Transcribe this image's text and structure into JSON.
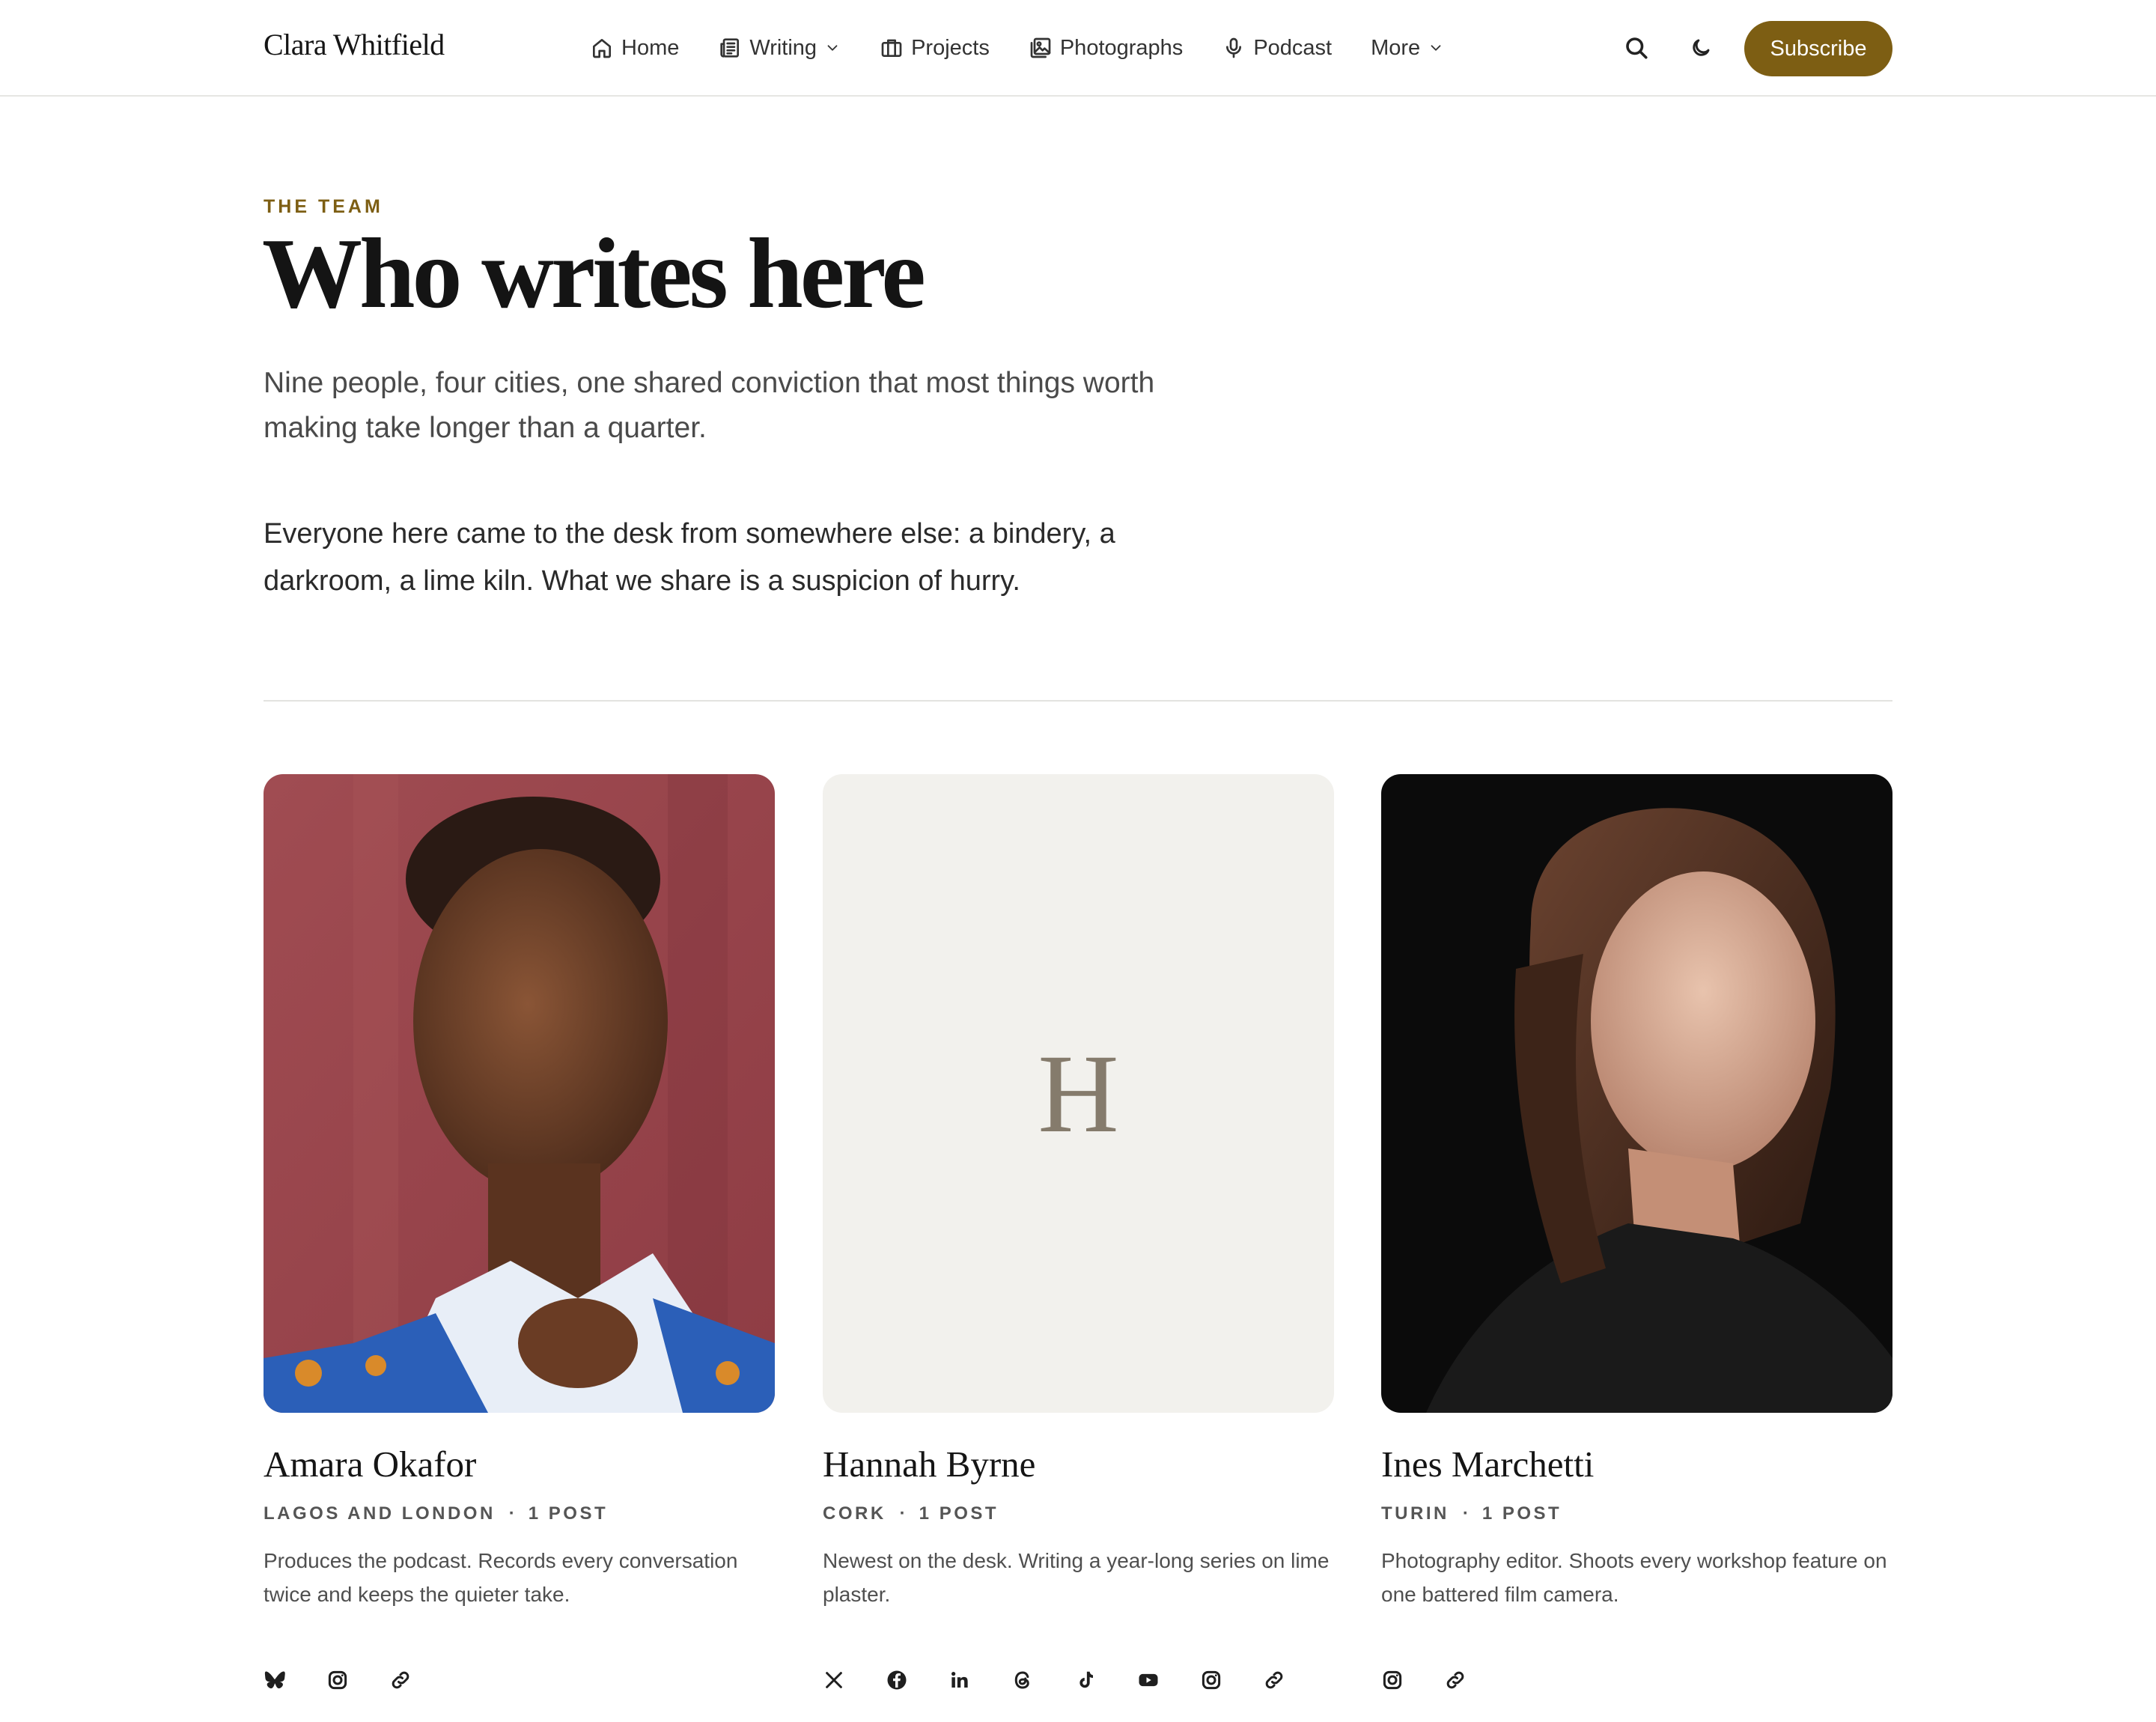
{
  "header": {
    "logo": "Clara Whitfield",
    "nav": [
      {
        "label": "Home",
        "icon": "home-icon"
      },
      {
        "label": "Writing",
        "icon": "newspaper-icon",
        "dropdown": true
      },
      {
        "label": "Projects",
        "icon": "briefcase-icon"
      },
      {
        "label": "Photographs",
        "icon": "image-icon"
      },
      {
        "label": "Podcast",
        "icon": "microphone-icon"
      },
      {
        "label": "More",
        "dropdown": true
      }
    ],
    "search_icon": "search-icon",
    "theme_icon": "moon-icon",
    "subscribe_label": "Subscribe"
  },
  "hero": {
    "eyebrow": "THE TEAM",
    "title": "Who writes here",
    "lead": "Nine people, four cities, one shared conviction that most things worth making take longer than a quarter.",
    "intro": "Everyone here came to the desk from somewhere else: a bindery, a darkroom, a lime kiln. What we share is a suspicion of hurry."
  },
  "team": [
    {
      "name": "Amara Okafor",
      "location": "LAGOS AND LONDON",
      "posts": "1 POST",
      "bio": "Produces the podcast. Records every conversation twice and keeps the quieter take.",
      "photo": "portrait-photo",
      "socials": [
        "bluesky-icon",
        "instagram-icon",
        "link-icon"
      ]
    },
    {
      "name": "Hannah Byrne",
      "location": "CORK",
      "posts": "1 POST",
      "bio": "Newest on the desk. Writing a year-long series on lime plaster.",
      "initial": "H",
      "socials": [
        "x-icon",
        "facebook-icon",
        "linkedin-icon",
        "threads-icon",
        "tiktok-icon",
        "youtube-icon",
        "instagram-icon",
        "link-icon"
      ]
    },
    {
      "name": "Ines Marchetti",
      "location": "TURIN",
      "posts": "1 POST",
      "bio": "Photography editor. Shoots every workshop feature on one battered film camera.",
      "photo": "portrait-photo",
      "socials": [
        "instagram-icon",
        "link-icon"
      ]
    }
  ],
  "colors": {
    "accent": "#7d5e13",
    "placeholder_bg": "#f2f1ed",
    "divider": "#e3e3e0"
  }
}
